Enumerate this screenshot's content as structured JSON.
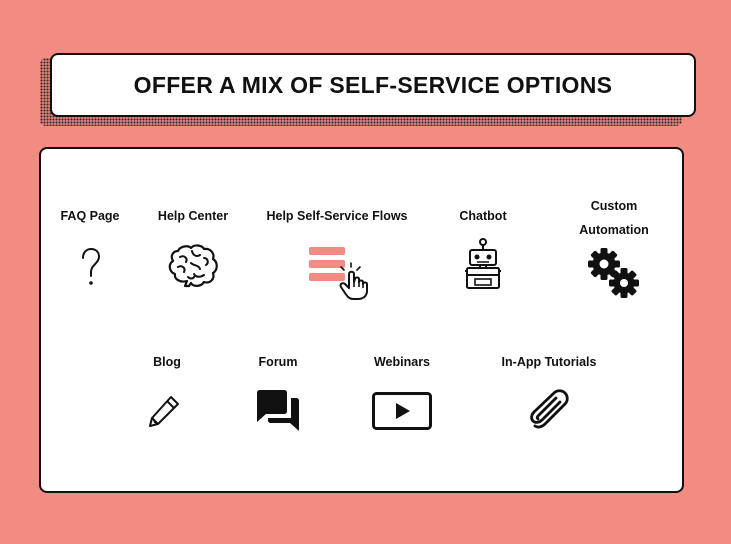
{
  "title": "OFFER A MIX OF SELF-SERVICE OPTIONS",
  "row1": [
    {
      "label": "FAQ Page",
      "icon": "question-mark-icon"
    },
    {
      "label": "Help Center",
      "icon": "brain-icon"
    },
    {
      "label": "Help Self-Service Flows",
      "icon": "list-pointer-icon"
    },
    {
      "label": "Chatbot",
      "icon": "robot-icon"
    },
    {
      "label_line1": "Custom",
      "label_line2": "Automation",
      "icon": "gears-icon"
    }
  ],
  "row2": [
    {
      "label": "Blog",
      "icon": "pencil-icon"
    },
    {
      "label": "Forum",
      "icon": "chat-bubbles-icon"
    },
    {
      "label": "Webinars",
      "icon": "video-play-icon"
    },
    {
      "label": "In-App Tutorials",
      "icon": "paperclip-icon"
    }
  ],
  "colors": {
    "background": "#f28b82",
    "accent": "#f28b82",
    "ink": "#111111"
  }
}
